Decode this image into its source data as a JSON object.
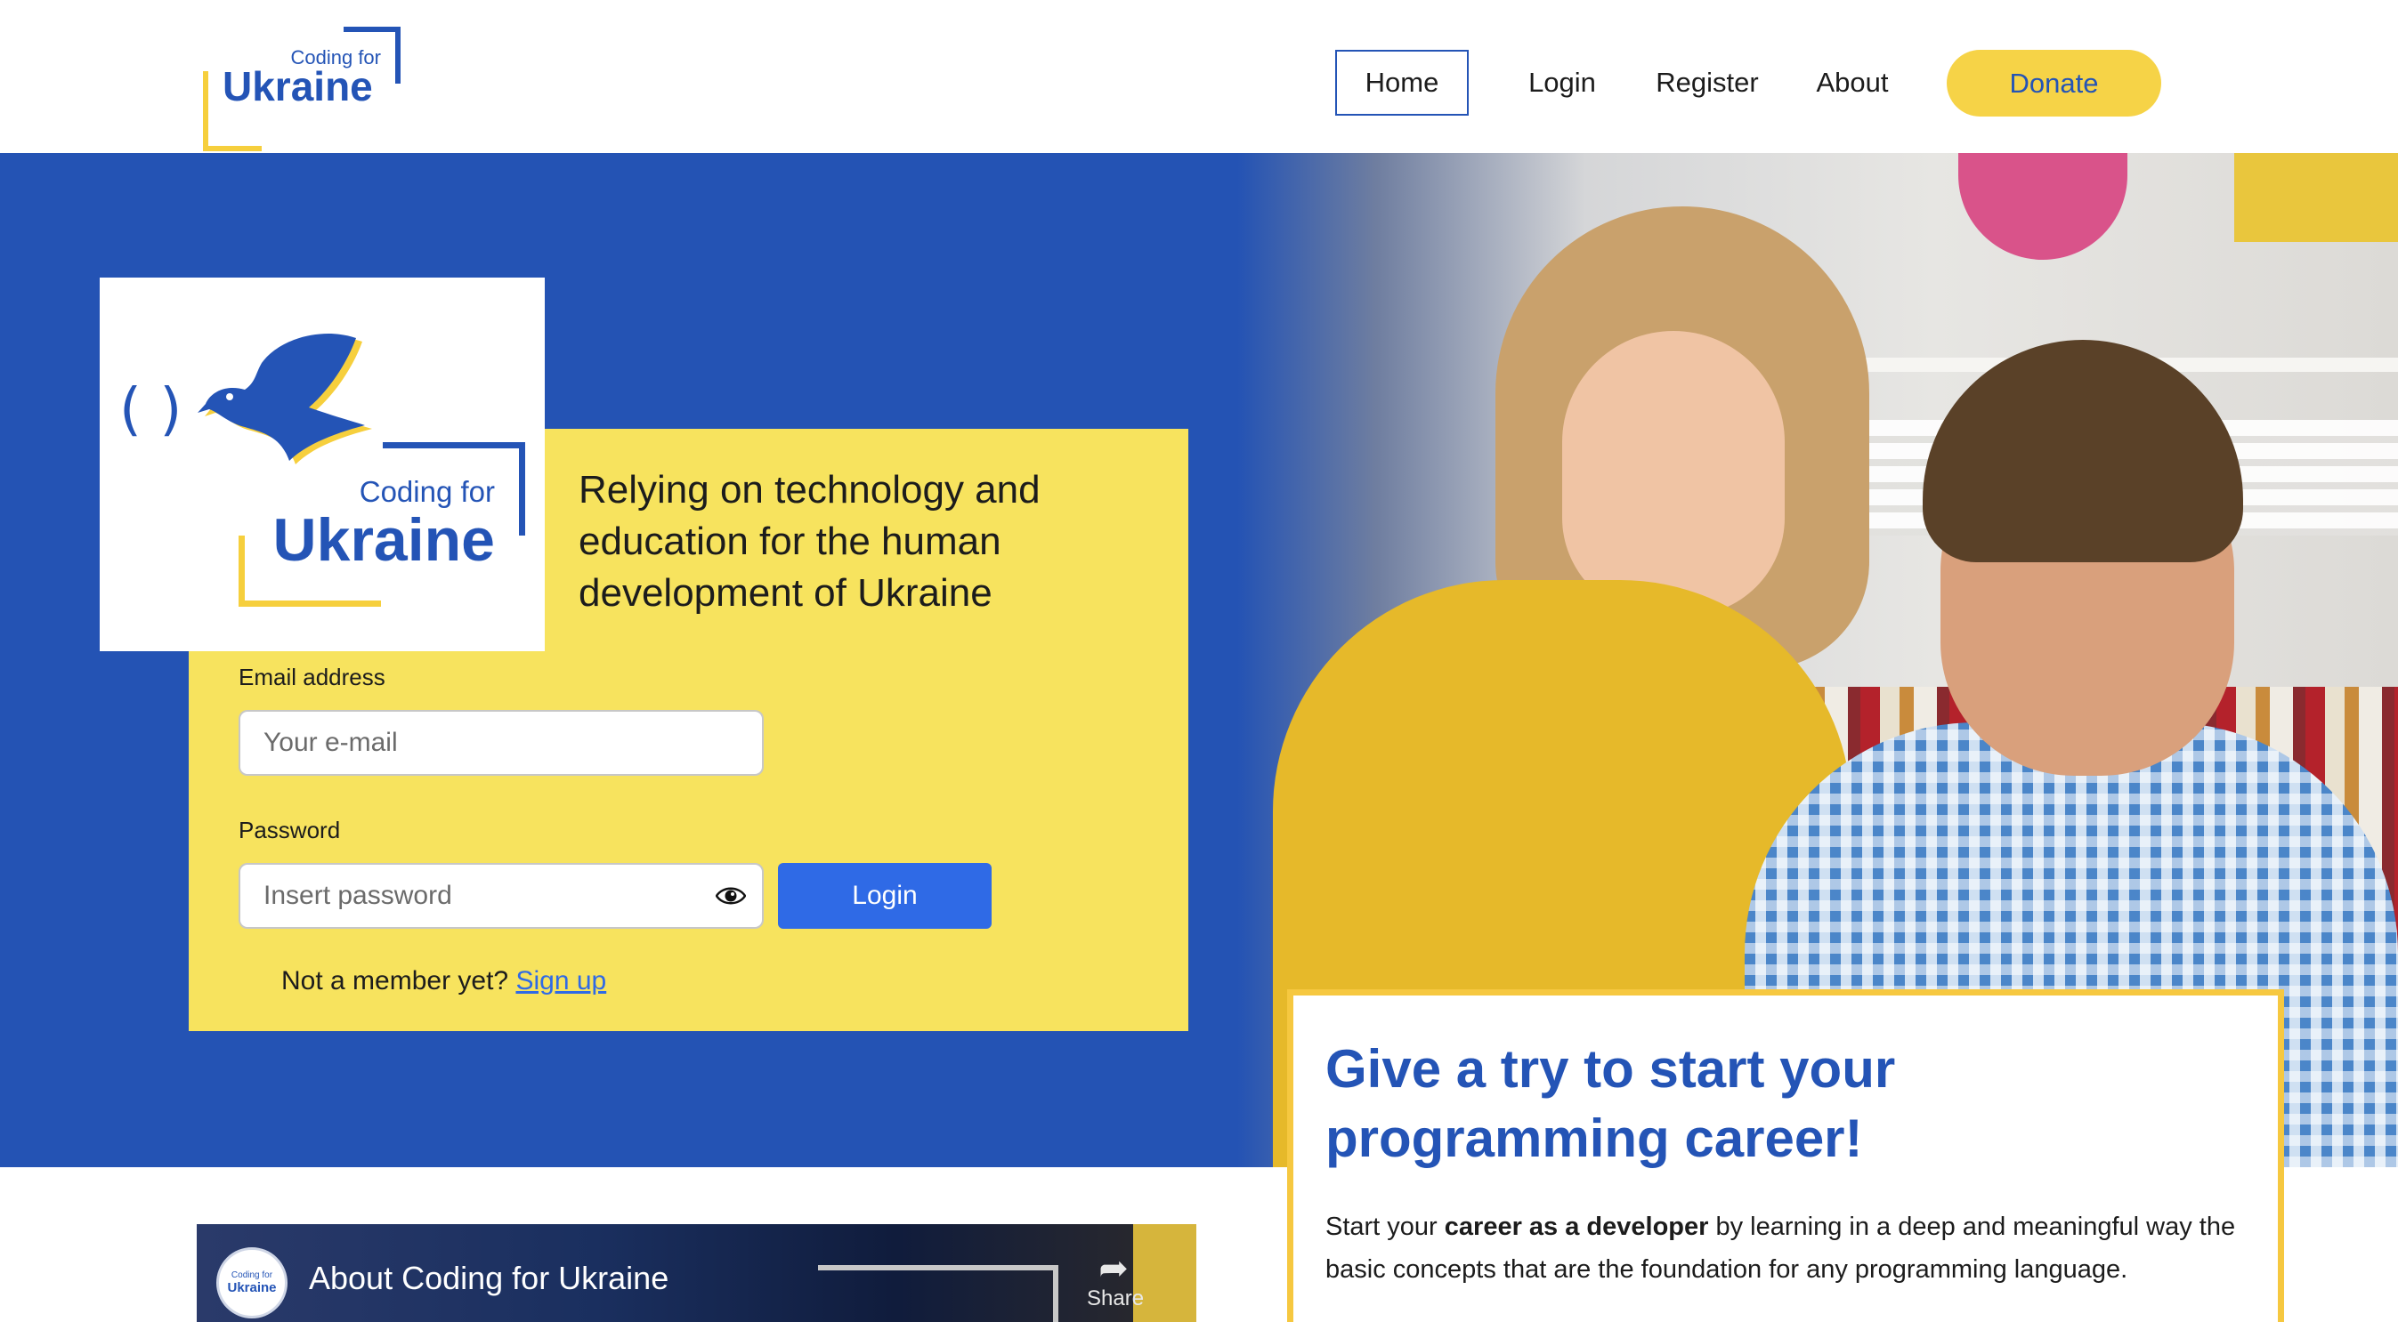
{
  "header": {
    "brand": {
      "small": "Coding for",
      "big": "Ukraine"
    },
    "nav": {
      "home": "Home",
      "login": "Login",
      "register": "Register",
      "about": "About",
      "donate": "Donate"
    }
  },
  "hero": {
    "logo": {
      "small": "Coding for",
      "big": "Ukraine",
      "paren": "( )"
    },
    "tagline": "Relying on technology and education for the human development of Ukraine",
    "form": {
      "email_label": "Email address",
      "email_placeholder": "Your e-mail",
      "password_label": "Password",
      "password_placeholder": "Insert password",
      "login_button": "Login",
      "member_text": "Not a member yet?",
      "signup_link": "Sign up"
    }
  },
  "career": {
    "title": "Give a try to start your programming career!",
    "text_before": "Start your ",
    "text_bold": "career as a developer",
    "text_after": " by learning in a deep and meaningful way the basic concepts that are the foundation for any programming language."
  },
  "video": {
    "title": "About Coding for Ukraine",
    "channel_small": "Coding for",
    "channel_big": "Ukraine",
    "share": "Share"
  },
  "icons": {
    "eye": "eye-icon",
    "share": "share-arrow-icon",
    "dove": "dove-icon"
  },
  "colors": {
    "blue": "#2454b6",
    "yellow": "#f7e35e",
    "button": "#2f6ae6",
    "donate": "#f6d347"
  }
}
